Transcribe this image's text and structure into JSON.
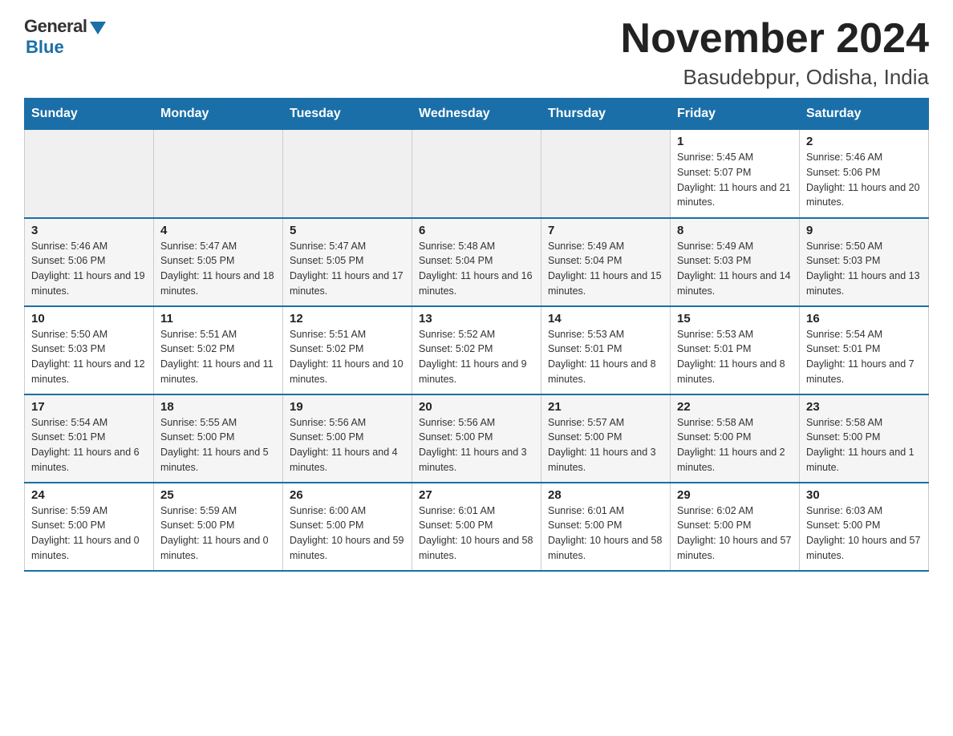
{
  "header": {
    "logo_general": "General",
    "logo_blue": "Blue",
    "month_title": "November 2024",
    "location": "Basudebpur, Odisha, India"
  },
  "weekdays": [
    "Sunday",
    "Monday",
    "Tuesday",
    "Wednesday",
    "Thursday",
    "Friday",
    "Saturday"
  ],
  "weeks": [
    [
      {
        "day": "",
        "empty": true
      },
      {
        "day": "",
        "empty": true
      },
      {
        "day": "",
        "empty": true
      },
      {
        "day": "",
        "empty": true
      },
      {
        "day": "",
        "empty": true
      },
      {
        "day": "1",
        "sunrise": "5:45 AM",
        "sunset": "5:07 PM",
        "daylight": "11 hours and 21 minutes."
      },
      {
        "day": "2",
        "sunrise": "5:46 AM",
        "sunset": "5:06 PM",
        "daylight": "11 hours and 20 minutes."
      }
    ],
    [
      {
        "day": "3",
        "sunrise": "5:46 AM",
        "sunset": "5:06 PM",
        "daylight": "11 hours and 19 minutes."
      },
      {
        "day": "4",
        "sunrise": "5:47 AM",
        "sunset": "5:05 PM",
        "daylight": "11 hours and 18 minutes."
      },
      {
        "day": "5",
        "sunrise": "5:47 AM",
        "sunset": "5:05 PM",
        "daylight": "11 hours and 17 minutes."
      },
      {
        "day": "6",
        "sunrise": "5:48 AM",
        "sunset": "5:04 PM",
        "daylight": "11 hours and 16 minutes."
      },
      {
        "day": "7",
        "sunrise": "5:49 AM",
        "sunset": "5:04 PM",
        "daylight": "11 hours and 15 minutes."
      },
      {
        "day": "8",
        "sunrise": "5:49 AM",
        "sunset": "5:03 PM",
        "daylight": "11 hours and 14 minutes."
      },
      {
        "day": "9",
        "sunrise": "5:50 AM",
        "sunset": "5:03 PM",
        "daylight": "11 hours and 13 minutes."
      }
    ],
    [
      {
        "day": "10",
        "sunrise": "5:50 AM",
        "sunset": "5:03 PM",
        "daylight": "11 hours and 12 minutes."
      },
      {
        "day": "11",
        "sunrise": "5:51 AM",
        "sunset": "5:02 PM",
        "daylight": "11 hours and 11 minutes."
      },
      {
        "day": "12",
        "sunrise": "5:51 AM",
        "sunset": "5:02 PM",
        "daylight": "11 hours and 10 minutes."
      },
      {
        "day": "13",
        "sunrise": "5:52 AM",
        "sunset": "5:02 PM",
        "daylight": "11 hours and 9 minutes."
      },
      {
        "day": "14",
        "sunrise": "5:53 AM",
        "sunset": "5:01 PM",
        "daylight": "11 hours and 8 minutes."
      },
      {
        "day": "15",
        "sunrise": "5:53 AM",
        "sunset": "5:01 PM",
        "daylight": "11 hours and 8 minutes."
      },
      {
        "day": "16",
        "sunrise": "5:54 AM",
        "sunset": "5:01 PM",
        "daylight": "11 hours and 7 minutes."
      }
    ],
    [
      {
        "day": "17",
        "sunrise": "5:54 AM",
        "sunset": "5:01 PM",
        "daylight": "11 hours and 6 minutes."
      },
      {
        "day": "18",
        "sunrise": "5:55 AM",
        "sunset": "5:00 PM",
        "daylight": "11 hours and 5 minutes."
      },
      {
        "day": "19",
        "sunrise": "5:56 AM",
        "sunset": "5:00 PM",
        "daylight": "11 hours and 4 minutes."
      },
      {
        "day": "20",
        "sunrise": "5:56 AM",
        "sunset": "5:00 PM",
        "daylight": "11 hours and 3 minutes."
      },
      {
        "day": "21",
        "sunrise": "5:57 AM",
        "sunset": "5:00 PM",
        "daylight": "11 hours and 3 minutes."
      },
      {
        "day": "22",
        "sunrise": "5:58 AM",
        "sunset": "5:00 PM",
        "daylight": "11 hours and 2 minutes."
      },
      {
        "day": "23",
        "sunrise": "5:58 AM",
        "sunset": "5:00 PM",
        "daylight": "11 hours and 1 minute."
      }
    ],
    [
      {
        "day": "24",
        "sunrise": "5:59 AM",
        "sunset": "5:00 PM",
        "daylight": "11 hours and 0 minutes."
      },
      {
        "day": "25",
        "sunrise": "5:59 AM",
        "sunset": "5:00 PM",
        "daylight": "11 hours and 0 minutes."
      },
      {
        "day": "26",
        "sunrise": "6:00 AM",
        "sunset": "5:00 PM",
        "daylight": "10 hours and 59 minutes."
      },
      {
        "day": "27",
        "sunrise": "6:01 AM",
        "sunset": "5:00 PM",
        "daylight": "10 hours and 58 minutes."
      },
      {
        "day": "28",
        "sunrise": "6:01 AM",
        "sunset": "5:00 PM",
        "daylight": "10 hours and 58 minutes."
      },
      {
        "day": "29",
        "sunrise": "6:02 AM",
        "sunset": "5:00 PM",
        "daylight": "10 hours and 57 minutes."
      },
      {
        "day": "30",
        "sunrise": "6:03 AM",
        "sunset": "5:00 PM",
        "daylight": "10 hours and 57 minutes."
      }
    ]
  ]
}
